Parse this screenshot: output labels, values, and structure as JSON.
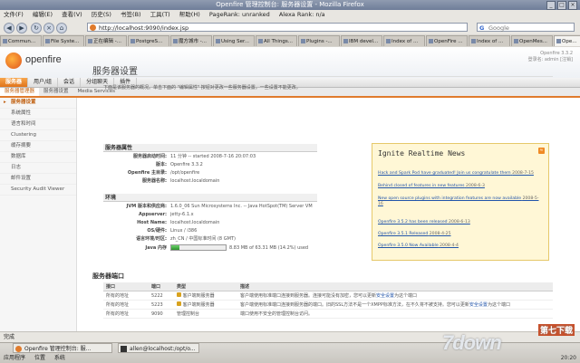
{
  "window": {
    "title": "Openfire 管理控制台: 服务器设置 - Mozilla Firefox",
    "controls": [
      "_",
      "□",
      "×"
    ]
  },
  "menubar": {
    "items": [
      "文件(F)",
      "编辑(E)",
      "查看(V)",
      "历史(S)",
      "书签(B)",
      "工具(T)",
      "帮助(H)"
    ],
    "pagerank": "PageRank: unranked",
    "alexa": "Alexa Rank: n/a"
  },
  "nav": {
    "url": "http://localhost:9090/index.jsp",
    "search_placeholder": "Google"
  },
  "tabs": [
    "Commun...",
    "File Syste...",
    "正在编辑 -...",
    "PostgreS...",
    "魔方城市 -...",
    "Using Ser...",
    "All Things...",
    "Plugins -...",
    "IBM devel...",
    "Index of ...",
    "OpenFire ...",
    "Index of ...",
    "OpenMes...",
    "Ope..."
  ],
  "openfire": {
    "logo": "openfire",
    "header_right": [
      "Openfire 3.3.2",
      "登录名: admin [注销]"
    ],
    "main_nav": [
      "服务器",
      "用户/组",
      "会话",
      "分组聊天",
      "插件"
    ],
    "sub_nav": [
      "服务器管理器",
      "服务器设置",
      "Media Services"
    ],
    "sidebar": [
      "服务器设置",
      "系统属性",
      "语言和时间",
      "Clustering",
      "缓存摘要",
      "数据库",
      "日志",
      "邮件设置",
      "Security Audit Viewer"
    ],
    "page_title": "服务器设置",
    "intro": "下面是该服务器的概况。单击下面的 \"编辑属性\" 按钮对更改一些服务器设置。一些设置不能更改。",
    "props_title": "服务器属性",
    "props": [
      {
        "k": "服务器启动时间:",
        "v": "11 分钟 -- started 2008-7-16 20:07:03"
      },
      {
        "k": "版本:",
        "v": "Openfire 3.3.2"
      },
      {
        "k": "Openfire 主目录:",
        "v": "/opt/openfire"
      },
      {
        "k": "服务器名称:",
        "v": "localhost.localdomain"
      }
    ],
    "env_title": "环境",
    "env": [
      {
        "k": "JVM 版本和供应商:",
        "v": "1.6.0_06 Sun Microsystems Inc. -- Java HotSpot(TM) Server VM"
      },
      {
        "k": "Appserver:",
        "v": "jetty-6.1.x"
      },
      {
        "k": "Host Name:",
        "v": "localhost.localdomain"
      },
      {
        "k": "OS/硬件:",
        "v": "Linux / i386"
      },
      {
        "k": "语言环境/时区:",
        "v": "zh_CN / 中国标准时间 (8 GMT)"
      }
    ],
    "memory": {
      "k": "Java 内存",
      "v": "8.83 MB of 63.31 MB (14.2%) used",
      "fraction": 0.142
    },
    "news": {
      "title": "Ignite Realtime News",
      "items": [
        {
          "text": "Hack and Spark Pod have graduated! Join us congratulate them",
          "date": "2008-7-15"
        },
        {
          "text": "Behind closed of features in new features",
          "date": "2008-6-3"
        },
        {
          "text": "New open source plugins with integration features are now available",
          "date": "2008-5-16"
        },
        {
          "text": "Openfire 3.5.2 has been released",
          "date": "2008-6-13"
        },
        {
          "text": "Openfire 3.5.1 Released",
          "date": "2008-4-25"
        },
        {
          "text": "Openfire 3.5.0 Now Available",
          "date": "2008-4-4"
        }
      ]
    },
    "ports_title": "服务器端口",
    "ports_headers": [
      "接口",
      "端口",
      "类型",
      "描述"
    ],
    "ports": [
      {
        "iface": "所有的地址",
        "port": "5222",
        "type": "客户端到服务器",
        "desc": "客户端使用标准端口连接到服务器。连接可能没有加密，您可以更新",
        "link": "安全设置",
        "tail": "为这个端口"
      },
      {
        "iface": "所有的地址",
        "port": "5223",
        "type": "客户端到服务器",
        "desc": "客户端使用标准端口连接到服务器的端口。旧的SSL方法不是一个XMPP标准方法，在不久将不被支持。您可以更新",
        "link": "安全设置",
        "tail": "为这个端口"
      },
      {
        "iface": "所有的地址",
        "port": "9090",
        "type": "管理控制台",
        "desc": "端口使用不安全的管理控制台访问。",
        "link": "",
        "tail": ""
      }
    ]
  },
  "status": {
    "text": "完成"
  },
  "taskbar": {
    "tasks": [
      "Openfire 管理控制台: 服...",
      "allen@localhost:/opt/o..."
    ],
    "menus": [
      "应用程序",
      "位置",
      "系统"
    ],
    "clock": "20:20"
  },
  "watermark": {
    "brand": "7down",
    "cn": "第七下载"
  },
  "colors": {
    "accent": "#e07b2c",
    "news_bg": "#fff7d6",
    "link": "#2255aa"
  }
}
